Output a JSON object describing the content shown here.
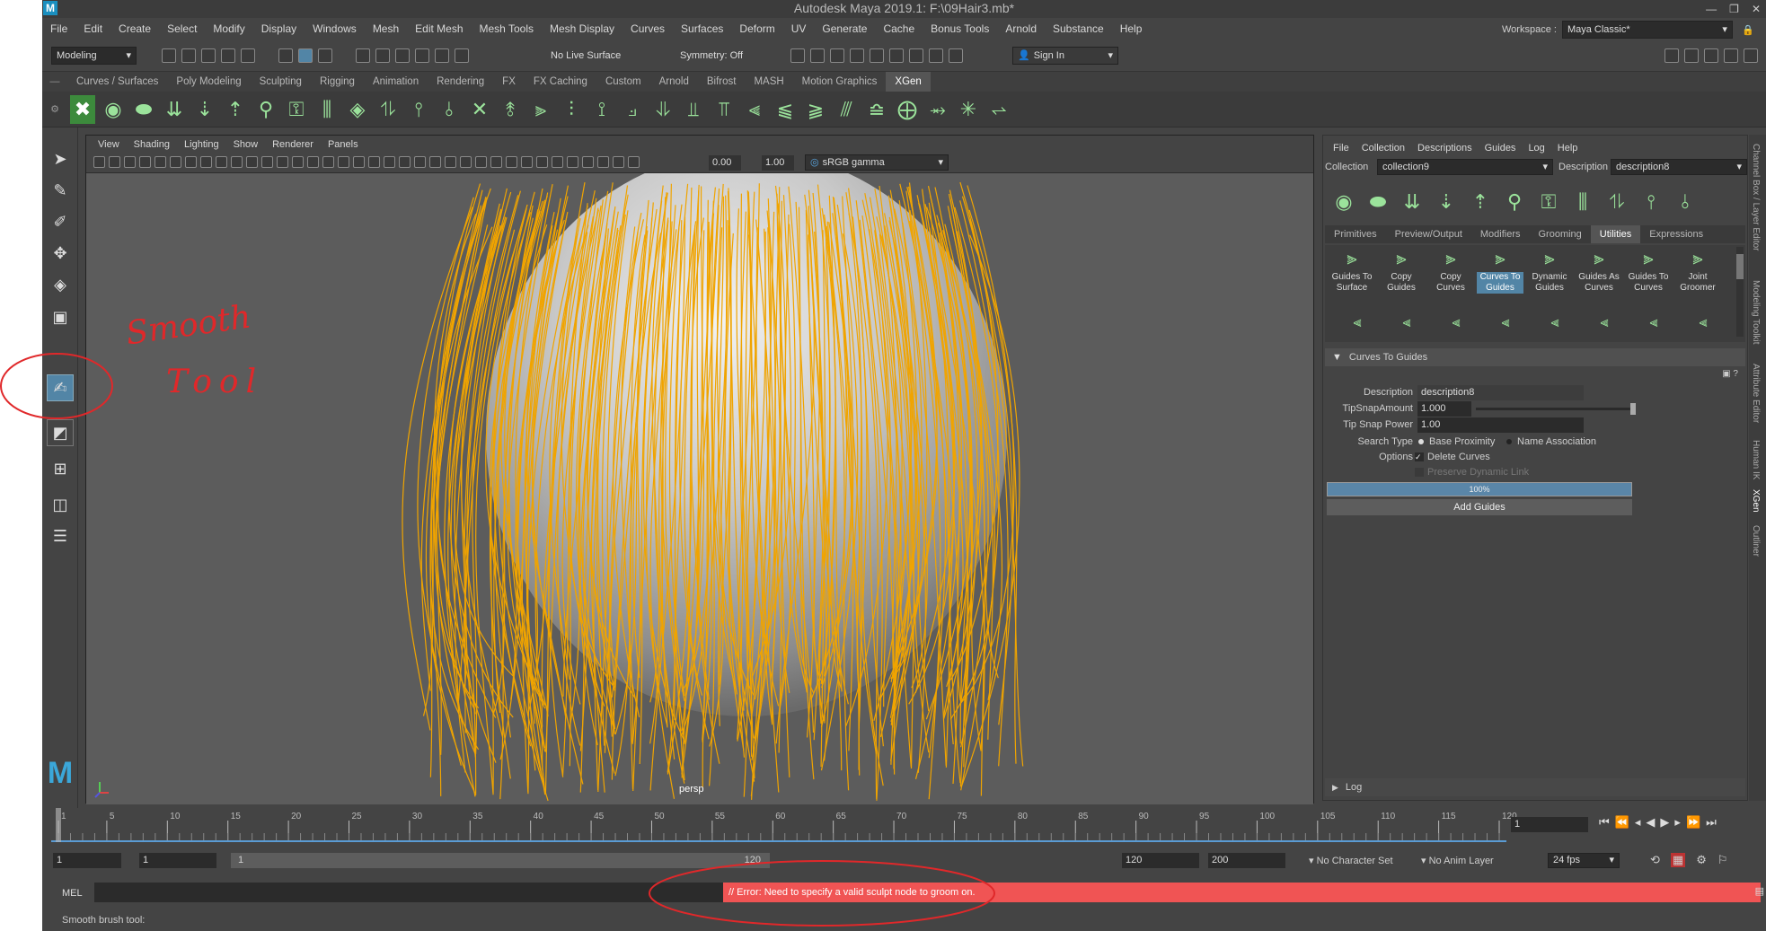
{
  "title": "Autodesk Maya 2019.1: F:\\09Hair3.mb*",
  "menus": [
    "File",
    "Edit",
    "Create",
    "Select",
    "Modify",
    "Display",
    "Windows",
    "Mesh",
    "Edit Mesh",
    "Mesh Tools",
    "Mesh Display",
    "Curves",
    "Surfaces",
    "Deform",
    "UV",
    "Generate",
    "Cache",
    "Bonus Tools",
    "Arnold",
    "Substance",
    "Help"
  ],
  "workspace": {
    "label": "Workspace :",
    "value": "Maya Classic*"
  },
  "status": {
    "mode": "Modeling",
    "live_surface": "No Live Surface",
    "symmetry": "Symmetry: Off",
    "sign_in": "Sign In"
  },
  "shelf_tabs": [
    "Curves / Surfaces",
    "Poly Modeling",
    "Sculpting",
    "Rigging",
    "Animation",
    "Rendering",
    "FX",
    "FX Caching",
    "Custom",
    "Arnold",
    "Bifrost",
    "MASH",
    "Motion Graphics",
    "XGen"
  ],
  "active_shelf": "XGen",
  "annotation": {
    "text_line1": "Smooth",
    "text_line2": "Tool"
  },
  "viewport": {
    "menus": [
      "View",
      "Shading",
      "Lighting",
      "Show",
      "Renderer",
      "Panels"
    ],
    "exposure": "0.00",
    "gamma": "1.00",
    "color_space": "sRGB gamma",
    "camera": "persp"
  },
  "xgen": {
    "menus": [
      "File",
      "Collection",
      "Descriptions",
      "Guides",
      "Log",
      "Help"
    ],
    "collection_label": "Collection",
    "collection": "collection9",
    "description_label": "Description",
    "description": "description8",
    "tabs": [
      "Primitives",
      "Preview/Output",
      "Modifiers",
      "Grooming",
      "Utilities",
      "Expressions"
    ],
    "active_tab": "Utilities",
    "utilities": [
      "Guides To Surface",
      "Copy Guides",
      "Copy Curves",
      "Curves To Guides",
      "Dynamic Guides",
      "Guides As Curves",
      "Guides To Curves",
      "Joint Groomer"
    ],
    "active_utility": "Curves To Guides",
    "section": "Curves To Guides",
    "form": {
      "description_label": "Description",
      "description": "description8",
      "tipsnap_label": "TipSnapAmount",
      "tipsnap": "1.000",
      "tipsnap_power_label": "Tip Snap Power",
      "tipsnap_power": "1.00",
      "search_type_label": "Search Type",
      "search_opt1": "Base Proximity",
      "search_opt2": "Name Association",
      "options_label": "Options",
      "delete_curves": "Delete Curves",
      "preserve_link": "Preserve Dynamic Link",
      "progress": "100%",
      "add_guides": "Add Guides"
    },
    "log": "Log"
  },
  "side_tabs": [
    "Channel Box / Layer Editor",
    "Modeling Toolkit",
    "Attribute Editor",
    "Human IK",
    "XGen",
    "Outliner"
  ],
  "timeline": {
    "ticks": [
      "1",
      "5",
      "10",
      "15",
      "20",
      "25",
      "30",
      "35",
      "40",
      "45",
      "50",
      "55",
      "60",
      "65",
      "70",
      "75",
      "80",
      "85",
      "90",
      "95",
      "100",
      "105",
      "110",
      "115",
      "120"
    ],
    "current": "1"
  },
  "range": {
    "start": "1",
    "anim_start": "1",
    "slider_start": "1",
    "slider_end": "120",
    "anim_end": "120",
    "end": "200",
    "char_set": "No Character Set",
    "anim_layer": "No Anim Layer",
    "fps": "24 fps"
  },
  "cmd": {
    "lang": "MEL",
    "error": "// Error: Need to specify a valid sculpt node to groom on."
  },
  "help": "Smooth brush tool:",
  "colors": {
    "hair": "#f0a400",
    "error_bg": "#f05454",
    "highlight": "#5285a6",
    "annotation": "#e0282a"
  }
}
